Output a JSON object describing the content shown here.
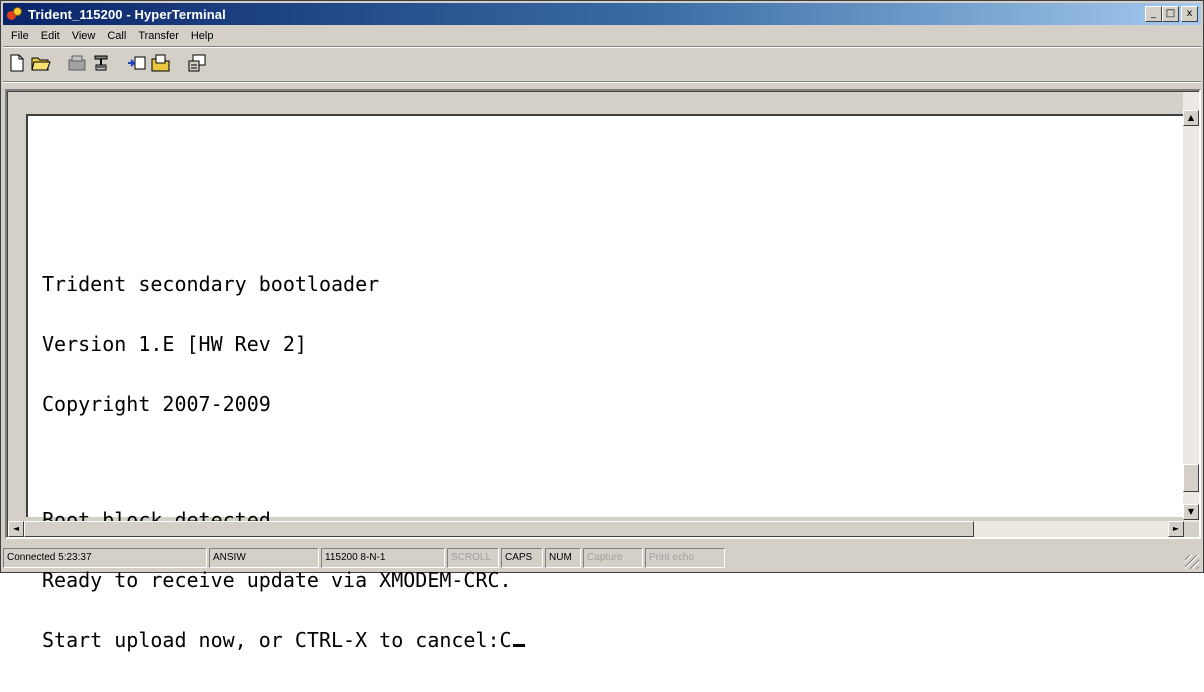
{
  "window": {
    "title": "Trident_115200 - HyperTerminal",
    "controls": {
      "minimize": "_",
      "maximize": "□",
      "close": "x"
    }
  },
  "menu": {
    "items": [
      "File",
      "Edit",
      "View",
      "Call",
      "Transfer",
      "Help"
    ]
  },
  "toolbar": {
    "icons": [
      "new-connection-icon",
      "open-icon",
      "disconnect-icon",
      "dial-icon",
      "send-icon",
      "receive-icon",
      "properties-icon"
    ]
  },
  "terminal": {
    "lines": [
      "Trident secondary bootloader",
      "Version 1.E [HW Rev 2]",
      "Copyright 2007-2009",
      "",
      "Boot block detected.",
      "Ready to receive update via XMODEM-CRC.",
      "Start upload now, or CTRL-X to cancel:C"
    ]
  },
  "scroll": {
    "up": "▲",
    "down": "▼",
    "left": "◄",
    "right": "►"
  },
  "status": {
    "connected": "Connected 5:23:37",
    "emulation": "ANSIW",
    "port_settings": "115200 8-N-1",
    "scroll": "SCROLL",
    "caps": "CAPS",
    "num": "NUM",
    "capture": "Capture",
    "print_echo": "Print echo"
  },
  "colors": {
    "titlebar_start": "#0a246a",
    "titlebar_end": "#a6caf0",
    "chrome": "#d4d0c8",
    "terminal_bg": "#ffffff",
    "terminal_text": "#000000"
  }
}
